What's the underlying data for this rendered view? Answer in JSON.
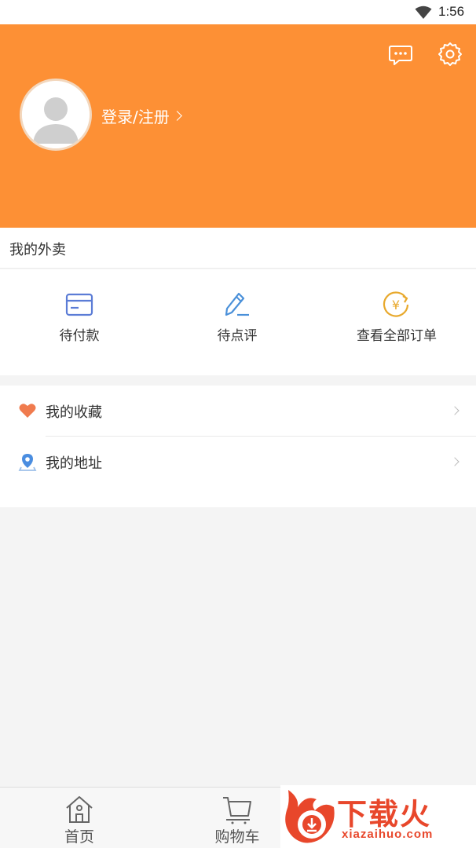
{
  "status_bar": {
    "time": "1:56",
    "wifi_icon": "wifi-icon"
  },
  "header": {
    "background_color": "#fd9035",
    "login_label": "登录/注册",
    "message_icon": "message-icon",
    "settings_icon": "gear-icon",
    "avatar_icon": "default-avatar-icon"
  },
  "section": {
    "title": "我的外卖"
  },
  "orders": [
    {
      "label": "待付款",
      "icon": "card-icon",
      "color": "#5b7cd6"
    },
    {
      "label": "待点评",
      "icon": "pen-icon",
      "color": "#4a90d9"
    },
    {
      "label": "查看全部订单",
      "icon": "yen-refresh-icon",
      "color": "#e8a92d"
    }
  ],
  "menu": [
    {
      "label": "我的收藏",
      "icon": "heart-icon",
      "color": "#f07b4e"
    },
    {
      "label": "我的地址",
      "icon": "location-pin-icon",
      "color": "#4a8de0"
    }
  ],
  "tabbar": [
    {
      "label": "首页",
      "icon": "home-icon"
    },
    {
      "label": "购物车",
      "icon": "cart-icon"
    }
  ],
  "watermark": {
    "brand": "下载火",
    "domain": "xiazaihuo.com"
  }
}
